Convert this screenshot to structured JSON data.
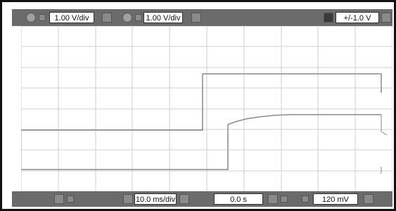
{
  "top_toolbar": {
    "ch1_scale": "1.00 V/div",
    "ch2_scale": "1.00 V/div",
    "range": "+/-1.0 V"
  },
  "bottom_toolbar": {
    "timebase": "10.0 ms/div",
    "trigger_time": "0.0 s",
    "trigger_level": "120 mV"
  },
  "waveform_colors": {
    "grid": "#cfcfcf",
    "trace": "#8a8a8a",
    "background": "#ffffff"
  }
}
